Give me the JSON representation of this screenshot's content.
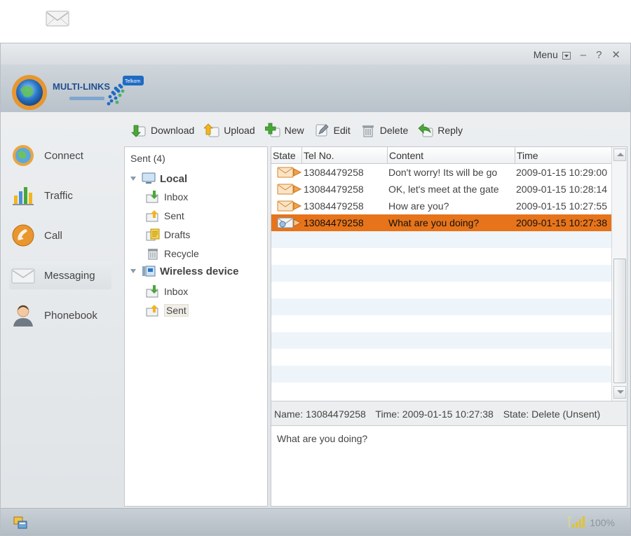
{
  "title_bar": {
    "menu_label": "Menu",
    "minimize_label": "–",
    "help_label": "?",
    "close_label": "✕"
  },
  "brand": {
    "logo_text": "MULTI-LINKS",
    "partner_text": "Telkom",
    "accent_color": "#2a76c8"
  },
  "toolbar": {
    "download": "Download",
    "upload": "Upload",
    "new": "New",
    "edit": "Edit",
    "delete": "Delete",
    "reply": "Reply"
  },
  "sidebar": {
    "items": [
      {
        "label": "Connect",
        "icon": "globe-icon"
      },
      {
        "label": "Traffic",
        "icon": "bar-chart-icon"
      },
      {
        "label": "Call",
        "icon": "phone-handset-icon"
      },
      {
        "label": "Messaging",
        "icon": "envelope-icon"
      },
      {
        "label": "Phonebook",
        "icon": "contact-person-icon"
      }
    ],
    "active": "Messaging"
  },
  "folders": {
    "title": "Sent (4)",
    "local": {
      "label": "Local",
      "items": [
        "Inbox",
        "Sent",
        "Drafts",
        "Recycle"
      ]
    },
    "device": {
      "label": "Wireless device",
      "items": [
        "Inbox",
        "Sent"
      ]
    },
    "selected": "Sent"
  },
  "messages": {
    "columns": {
      "state": "State",
      "tel": "Tel No.",
      "content": "Content",
      "time": "Time"
    },
    "rows": [
      {
        "tel": "13084479258",
        "content": "Don't worry! Its will be go",
        "time": "2009-01-15 10:29:00"
      },
      {
        "tel": "13084479258",
        "content": "OK, let's meet at the gate",
        "time": "2009-01-15 10:28:14"
      },
      {
        "tel": "13084479258",
        "content": "How are you?",
        "time": "2009-01-15 10:27:55"
      },
      {
        "tel": "13084479258",
        "content": "What are you doing?",
        "time": "2009-01-15 10:27:38"
      }
    ],
    "selected_index": 3,
    "selected_color": "#e7741a"
  },
  "detail": {
    "name": "Name: 13084479258",
    "time": "Time: 2009-01-15 10:27:38",
    "state": "State: Delete (Unsent)",
    "body": "What are you doing?"
  },
  "status": {
    "signal": "100%"
  }
}
